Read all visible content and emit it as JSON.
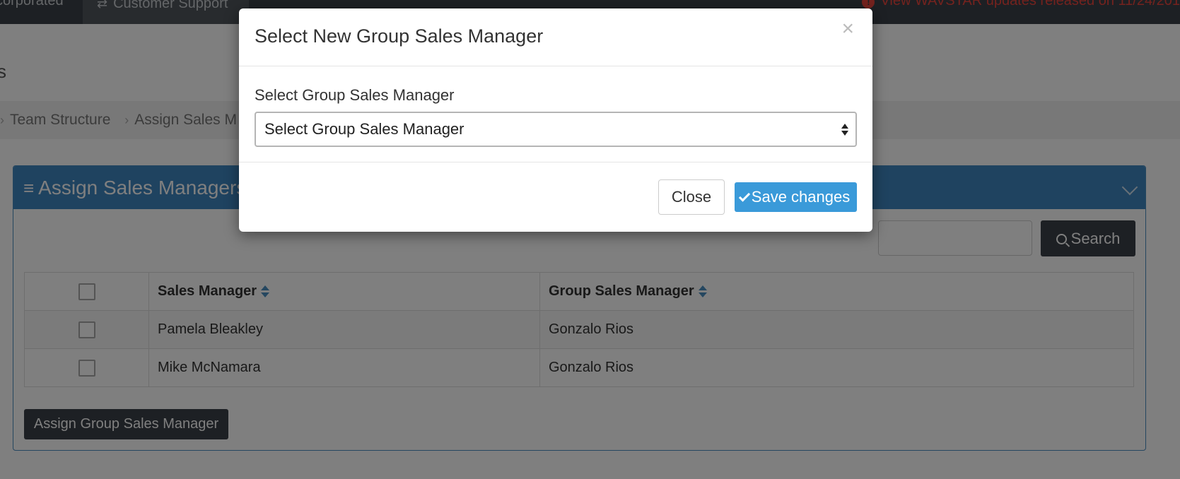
{
  "topbar": {
    "brand": "corporated",
    "support_tab": "Customer Support",
    "alert_text": "View WAVSTAR updates released on 11/24/201"
  },
  "page_title_stub": "s",
  "breadcrumb": {
    "items": [
      "Team Structure",
      "Assign Sales M"
    ]
  },
  "panel": {
    "title": "Assign Sales Managers",
    "search_button": "Search",
    "search_placeholder": "",
    "columns": [
      "Sales Manager",
      "Group Sales Manager"
    ],
    "rows": [
      {
        "sales_manager": "Pamela Bleakley",
        "group_sales_manager": "Gonzalo Rios"
      },
      {
        "sales_manager": "Mike McNamara",
        "group_sales_manager": "Gonzalo Rios"
      }
    ],
    "assign_button": "Assign Group Sales Manager"
  },
  "modal": {
    "title": "Select New Group Sales Manager",
    "close_glyph": "×",
    "field_label": "Select Group Sales Manager",
    "select_value": "Select Group Sales Manager",
    "close_button": "Close",
    "save_button": "Save changes"
  },
  "colors": {
    "topbar": "#3b4148",
    "panel_header": "#3f86c0",
    "primary": "#3a9ad9",
    "alert": "#e8453c"
  }
}
